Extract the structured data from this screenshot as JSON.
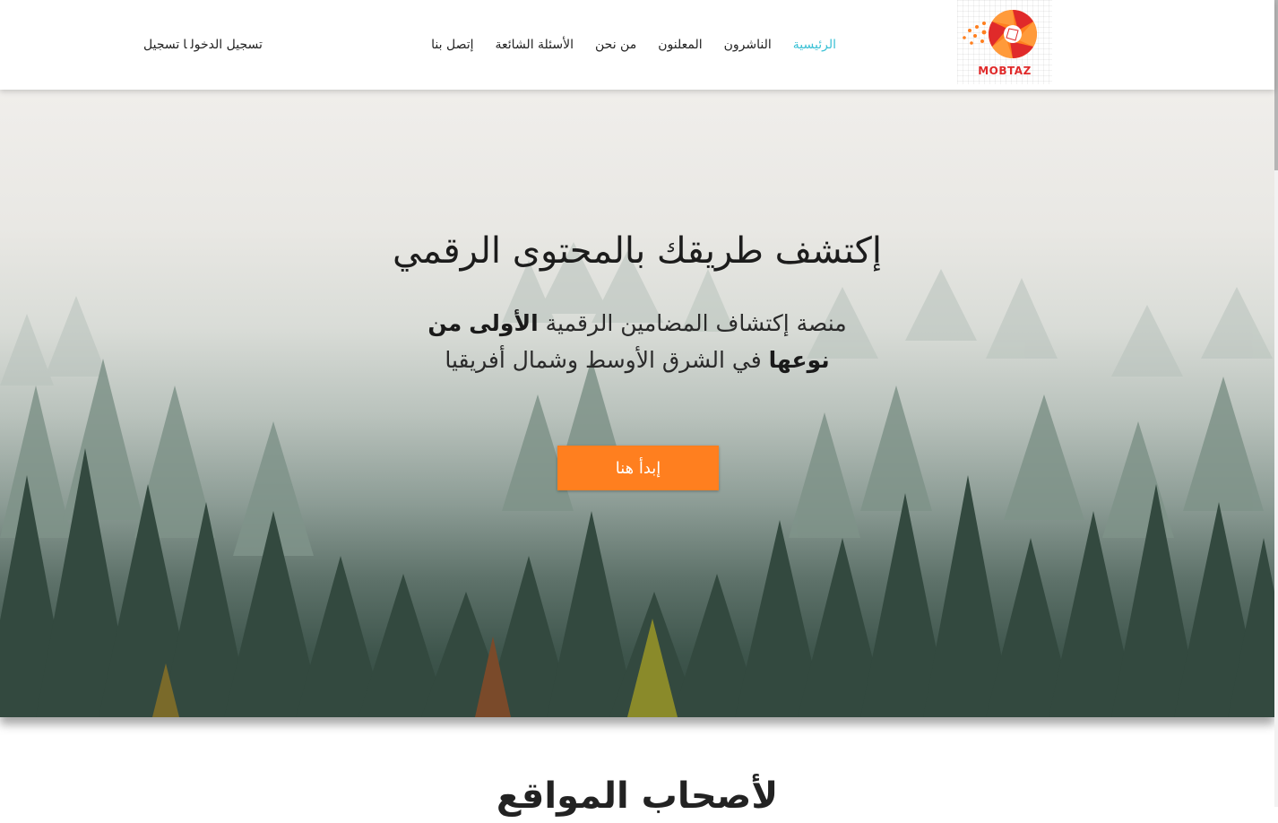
{
  "logo": {
    "text": "MOBTAZ",
    "icon": "aperture-logo-icon",
    "colors": {
      "orange": "#ff7f1f",
      "red": "#e02a2a"
    }
  },
  "nav": {
    "items": [
      {
        "label": "الرئيسية",
        "active": true
      },
      {
        "label": "الناشرون",
        "active": false
      },
      {
        "label": "المعلنون",
        "active": false
      },
      {
        "label": "من نحن",
        "active": false
      },
      {
        "label": "الأسئلة الشائعة",
        "active": false
      },
      {
        "label": "إتصل بنا",
        "active": false
      }
    ],
    "active_color": "#3bc1d5"
  },
  "auth": {
    "login_label": "تسجيل الدخول",
    "separator": "ا",
    "register_label": "تسجيل"
  },
  "hero": {
    "title": "إكتشف طريقك بالمحتوى الرقمي",
    "subtitle_part1": "منصة إكتشاف المضامين الرقمية ",
    "subtitle_bold1": "الأولى",
    "subtitle_bold2": "من نوعها",
    "subtitle_part2": " في الشرق الأوسط وشمال أفريقيا",
    "cta_label": "إبدأ هنا",
    "cta_color": "#ff7f1f",
    "background": "foggy-forest-image"
  },
  "section": {
    "title": "لأصحاب المواقع"
  }
}
